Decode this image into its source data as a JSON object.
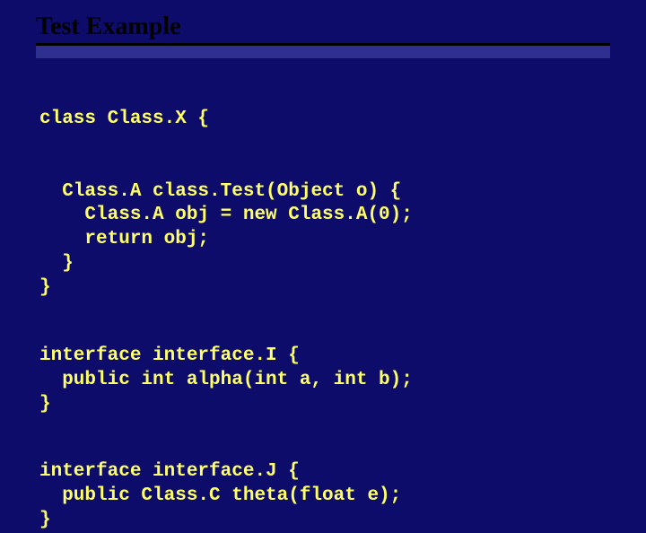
{
  "slide": {
    "title": "Test Example",
    "block1": {
      "l1": "class Class.X {",
      "l2": "  Class.A class.Test(Object o) {",
      "l3": "    Class.A obj = new Class.A(0);",
      "l4": "    return obj;",
      "l5": "  }",
      "l6": "}"
    },
    "block2": {
      "l1": "interface interface.I {",
      "l2": "  public int alpha(int a, int b);",
      "l3": "}"
    },
    "block3": {
      "l1": "interface interface.J {",
      "l2": "  public Class.C theta(float e);",
      "l3": "}"
    }
  }
}
